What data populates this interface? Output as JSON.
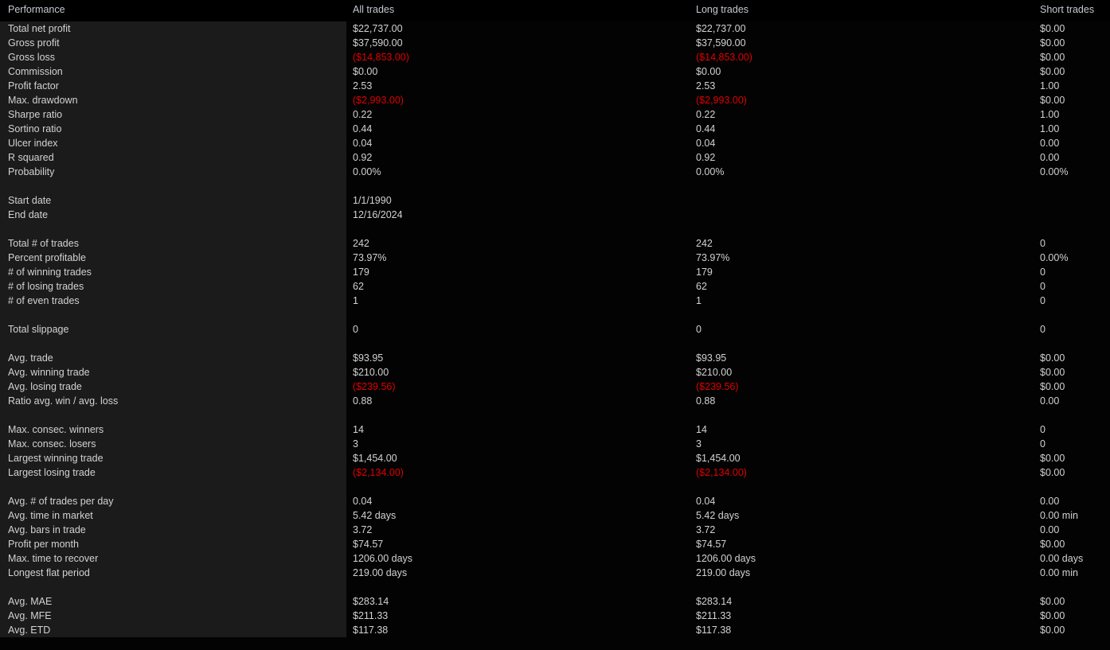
{
  "report": {
    "title": "Performance",
    "columns": [
      "Performance",
      "All trades",
      "Long trades",
      "Short trades"
    ],
    "colors": {
      "background": "#030303",
      "label_panel": "#1b1b1b",
      "header_text": "#c4cad2",
      "value_text": "#d2d2d2",
      "negative_text": "#e00000"
    }
  },
  "headers": {
    "performance": "Performance",
    "all_trades": "All trades",
    "long_trades": "Long trades",
    "short_trades": "Short trades"
  },
  "rows": [
    {
      "label": "Total net profit",
      "all": "$22,737.00",
      "long": "$22,737.00",
      "short": "$0.00"
    },
    {
      "label": "Gross profit",
      "all": "$37,590.00",
      "long": "$37,590.00",
      "short": "$0.00"
    },
    {
      "label": "Gross loss",
      "all": "($14,853.00)",
      "long": "($14,853.00)",
      "short": "$0.00",
      "neg": [
        "all",
        "long"
      ]
    },
    {
      "label": "Commission",
      "all": "$0.00",
      "long": "$0.00",
      "short": "$0.00"
    },
    {
      "label": "Profit factor",
      "all": "2.53",
      "long": "2.53",
      "short": "1.00"
    },
    {
      "label": "Max. drawdown",
      "all": "($2,993.00)",
      "long": "($2,993.00)",
      "short": "$0.00",
      "neg": [
        "all",
        "long"
      ]
    },
    {
      "label": "Sharpe ratio",
      "all": "0.22",
      "long": "0.22",
      "short": "1.00"
    },
    {
      "label": "Sortino ratio",
      "all": "0.44",
      "long": "0.44",
      "short": "1.00"
    },
    {
      "label": "Ulcer index",
      "all": "0.04",
      "long": "0.04",
      "short": "0.00"
    },
    {
      "label": "R squared",
      "all": "0.92",
      "long": "0.92",
      "short": "0.00"
    },
    {
      "label": "Probability",
      "all": "0.00%",
      "long": "0.00%",
      "short": "0.00%"
    },
    {
      "spacer": true
    },
    {
      "label": "Start date",
      "all": "1/1/1990",
      "long": "",
      "short": ""
    },
    {
      "label": "End date",
      "all": "12/16/2024",
      "long": "",
      "short": ""
    },
    {
      "spacer": true
    },
    {
      "label": "Total # of trades",
      "all": "242",
      "long": "242",
      "short": "0"
    },
    {
      "label": "Percent profitable",
      "all": "73.97%",
      "long": "73.97%",
      "short": "0.00%"
    },
    {
      "label": "# of winning trades",
      "all": "179",
      "long": "179",
      "short": "0"
    },
    {
      "label": "# of losing trades",
      "all": "62",
      "long": "62",
      "short": "0"
    },
    {
      "label": "# of even trades",
      "all": "1",
      "long": "1",
      "short": "0"
    },
    {
      "spacer": true
    },
    {
      "label": "Total slippage",
      "all": "0",
      "long": "0",
      "short": "0"
    },
    {
      "spacer": true
    },
    {
      "label": "Avg. trade",
      "all": "$93.95",
      "long": "$93.95",
      "short": "$0.00"
    },
    {
      "label": "Avg. winning trade",
      "all": "$210.00",
      "long": "$210.00",
      "short": "$0.00"
    },
    {
      "label": "Avg. losing trade",
      "all": "($239.56)",
      "long": "($239.56)",
      "short": "$0.00",
      "neg": [
        "all",
        "long"
      ]
    },
    {
      "label": "Ratio avg. win / avg. loss",
      "all": "0.88",
      "long": "0.88",
      "short": "0.00"
    },
    {
      "spacer": true
    },
    {
      "label": "Max. consec. winners",
      "all": "14",
      "long": "14",
      "short": "0"
    },
    {
      "label": "Max. consec. losers",
      "all": "3",
      "long": "3",
      "short": "0"
    },
    {
      "label": "Largest winning trade",
      "all": "$1,454.00",
      "long": "$1,454.00",
      "short": "$0.00"
    },
    {
      "label": "Largest losing trade",
      "all": "($2,134.00)",
      "long": "($2,134.00)",
      "short": "$0.00",
      "neg": [
        "all",
        "long"
      ]
    },
    {
      "spacer": true
    },
    {
      "label": "Avg. # of trades per day",
      "all": "0.04",
      "long": "0.04",
      "short": "0.00"
    },
    {
      "label": "Avg. time in market",
      "all": "5.42 days",
      "long": "5.42 days",
      "short": "0.00 min"
    },
    {
      "label": "Avg. bars in trade",
      "all": "3.72",
      "long": "3.72",
      "short": "0.00"
    },
    {
      "label": "Profit per month",
      "all": "$74.57",
      "long": "$74.57",
      "short": "$0.00"
    },
    {
      "label": "Max. time to recover",
      "all": "1206.00 days",
      "long": "1206.00 days",
      "short": "0.00 days"
    },
    {
      "label": "Longest flat period",
      "all": "219.00 days",
      "long": "219.00 days",
      "short": "0.00 min"
    },
    {
      "spacer": true
    },
    {
      "label": "Avg. MAE",
      "all": "$283.14",
      "long": "$283.14",
      "short": "$0.00"
    },
    {
      "label": "Avg. MFE",
      "all": "$211.33",
      "long": "$211.33",
      "short": "$0.00"
    },
    {
      "label": "Avg. ETD",
      "all": "$117.38",
      "long": "$117.38",
      "short": "$0.00"
    }
  ]
}
